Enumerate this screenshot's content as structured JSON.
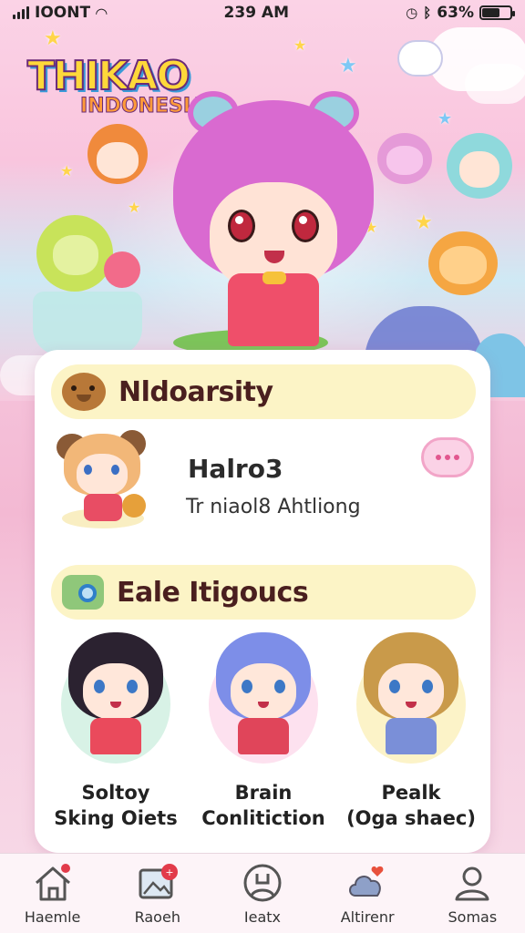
{
  "status_bar": {
    "carrier": "IOONT",
    "time": "239 AM",
    "battery": "63%",
    "battery_level": 0.63
  },
  "hero": {
    "logo_main": "THIKAO",
    "logo_sub": "INDONESIA"
  },
  "sections": {
    "community": {
      "title": "Nldoarsity"
    },
    "profile": {
      "name": "Halro3",
      "subtitle": "Tr niaol8 Ahtliong"
    },
    "gallery": {
      "title": "Eale Itigoucs",
      "characters": [
        {
          "line1": "Soltoy",
          "line2": "Sking Oiets",
          "hair": "#2b2230",
          "outfit": "#ea4a5c",
          "glow": "#d8f2e6"
        },
        {
          "line1": "Brain",
          "line2": "Conlitiction",
          "hair": "#7d8ee8",
          "outfit": "#e0455a",
          "glow": "#fde1ef"
        },
        {
          "line1": "Pealk",
          "line2": "(Oga shaec)",
          "hair": "#c99a4a",
          "outfit": "#7a8fd8",
          "glow": "#fcf3c8"
        }
      ]
    }
  },
  "nav": [
    {
      "label": "Haemle",
      "icon": "home-icon"
    },
    {
      "label": "Raoeh",
      "icon": "gallery-icon"
    },
    {
      "label": "Ieatx",
      "icon": "profile-circle-icon"
    },
    {
      "label": "Altirenr",
      "icon": "cloud-heart-icon"
    },
    {
      "label": "Somas",
      "icon": "user-icon"
    }
  ],
  "colors": {
    "accent_pink": "#f2a5c8",
    "header_yellow": "#fcf4c6",
    "title_brown": "#4a1f1f",
    "badge_red": "#e23b4a"
  }
}
